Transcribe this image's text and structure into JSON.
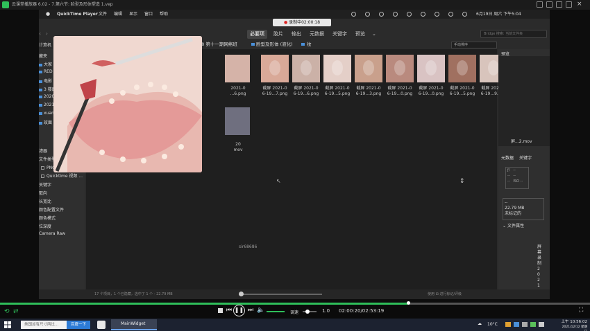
{
  "player": {
    "title": "云课堂播放器 6.02 - 7.第六节: 脸型及形体塑造 1.vep",
    "current_time": "02:00:20",
    "total_time": "02:53:19",
    "time_display": "02:00:20/02:53:19",
    "progress": 0.692,
    "speed_label": "调速",
    "speed_value": "1.0"
  },
  "mac_menu": {
    "apple": "",
    "app_name": "QuickTime Player",
    "items": [
      "文件",
      "编辑",
      "显示",
      "窗口",
      "帮助"
    ],
    "date": "6月19日 周六 下午5:04"
  },
  "recording_badge": "录制中02:00:18",
  "tabs": [
    {
      "label": "必要项",
      "active": true
    },
    {
      "label": "胶片",
      "active": false
    },
    {
      "label": "输出",
      "active": false
    },
    {
      "label": "元数据",
      "active": false
    },
    {
      "label": "关键字",
      "active": false
    },
    {
      "label": "预览",
      "active": false
    }
  ],
  "search_placeholder": "Bridge 搜索: 当前文件夹",
  "path": {
    "seg1": "08 第十一期网络班",
    "seg2": "脸型及形体 (液化)",
    "seg3": "妆"
  },
  "sort_label": "手动排序",
  "left_panel": {
    "top_label": "计算机",
    "favorites_header": "藏夹",
    "folders": [
      "大家",
      "RED",
      "电影",
      "3 楼面",
      "2020",
      "2021",
      "xuan",
      "玫面"
    ],
    "filter_header": "滤器",
    "file_type_header": "文件类型",
    "file_types": [
      "PNG 图像 (16)",
      "Quicktime 视频 ..."
    ],
    "filter_items": [
      "关键字",
      "取向",
      "长宽比",
      "颜色配置文件",
      "颜色模式",
      "位深度",
      "Camera Raw"
    ]
  },
  "thumbnails": [
    {
      "caption1": "截屏 2021-0",
      "caption2": "6-19...7.png",
      "color": "#d9a998"
    },
    {
      "caption1": "截屏 2021-0",
      "caption2": "6-19...6.png",
      "color": "#cbb1a7"
    },
    {
      "caption1": "截屏 2021-0",
      "caption2": "6-19...5.png",
      "color": "#e4cfc8"
    },
    {
      "caption1": "截屏 2021-0",
      "caption2": "6-19...3.png",
      "color": "#c9a08c"
    },
    {
      "caption1": "截屏 2021-0",
      "caption2": "6-19...0.png",
      "color": "#b98a7e"
    },
    {
      "caption1": "截屏 2021-0",
      "caption2": "6-19...0.png",
      "color": "#d9c3c3"
    },
    {
      "caption1": "截屏 2021-0",
      "caption2": "6-19...5.png",
      "color": "#a07060"
    },
    {
      "caption1": "截屏 2021-0",
      "caption2": "6-19...9.png",
      "color": "#d8c4bc"
    }
  ],
  "partial_captions": {
    "row1_cap1": "2021-0",
    "row1_cap2": "...6.png",
    "row2_cap1": "20",
    "row2_cap2": "mov"
  },
  "watermark": "sir68686",
  "right_panel": {
    "preview_header": "预览",
    "file_name": "屏...2.mov",
    "meta_tab": "元数据",
    "keyword_tab": "关键字",
    "file_size": "22.79 MB",
    "untagged": "未标记的",
    "file_props": "文件属性",
    "vertical_text": "屏幕录制2021"
  },
  "status": {
    "left": "17 个项目，1 个已隐藏，选中了 1 个 - 22.79 MB",
    "right": "使用 ⊞ 进行标记/评级"
  },
  "taskbar": {
    "search_placeholder": "美国加有尺寸两过...",
    "search_button": "百度一下",
    "task_label": "MainWidget",
    "weather": "10°C",
    "clock_time": "10:56:02",
    "clock_date": "2021/12/12 星期日",
    "ampm": "上午"
  }
}
